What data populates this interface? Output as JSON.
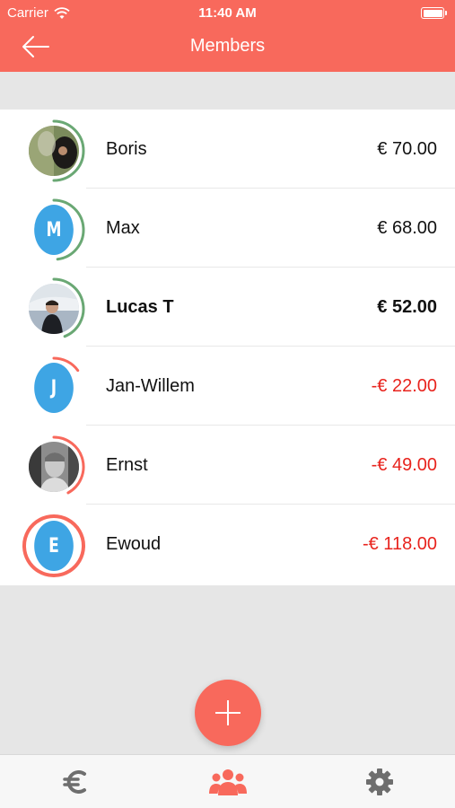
{
  "status_bar": {
    "carrier": "Carrier",
    "time": "11:40 AM"
  },
  "nav": {
    "title": "Members",
    "back_icon": "arrow-left-icon"
  },
  "members": [
    {
      "name": "Boris",
      "amount": "€ 70.00",
      "avatar": "photo",
      "balance_fraction": 0.5,
      "ring_color": "#6aa874",
      "negative": false,
      "bold": false
    },
    {
      "name": "Max",
      "amount": "€ 68.00",
      "avatar": "M",
      "balance_fraction": 0.48,
      "ring_color": "#6aa874",
      "negative": false,
      "bold": false
    },
    {
      "name": "Lucas T",
      "amount": "€ 52.00",
      "avatar": "photo",
      "balance_fraction": 0.44,
      "ring_color": "#6aa874",
      "negative": false,
      "bold": true
    },
    {
      "name": "Jan-Willem",
      "amount": "-€ 22.00",
      "avatar": "J",
      "balance_fraction": 0.15,
      "ring_color": "#f8695c",
      "negative": true,
      "bold": false
    },
    {
      "name": "Ernst",
      "amount": "-€ 49.00",
      "avatar": "photo",
      "balance_fraction": 0.42,
      "ring_color": "#f8695c",
      "negative": true,
      "bold": false
    },
    {
      "name": "Ewoud",
      "amount": "-€ 118.00",
      "avatar": "E",
      "balance_fraction": 1.0,
      "ring_color": "#f8695c",
      "negative": true,
      "bold": false
    }
  ],
  "fab": {
    "icon": "plus-icon"
  },
  "tabbar": {
    "tabs": [
      {
        "icon": "euro-icon",
        "color": "#6e6e6e"
      },
      {
        "icon": "group-icon",
        "color": "#f8695c"
      },
      {
        "icon": "gear-icon",
        "color": "#6e6e6e"
      }
    ]
  },
  "colors": {
    "accent": "#f8695c",
    "avatar_blue": "#3ea5e4",
    "positive_ring": "#6aa874",
    "negative_text": "#e8231d"
  }
}
